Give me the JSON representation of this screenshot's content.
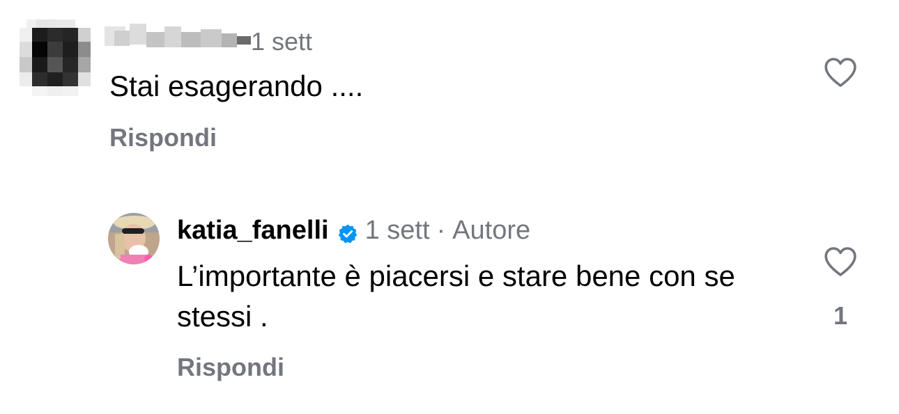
{
  "comments": [
    {
      "username_hidden": true,
      "time": "1 sett",
      "text": "Stai esagerando ....",
      "reply_label": "Rispondi",
      "like_icon": "heart-outline-icon"
    },
    {
      "username": "katia_fanelli",
      "verified": true,
      "time": "1 sett",
      "separator": "·",
      "author_badge": "Autore",
      "text": "L’importante è piacersi e stare bene con se stessi .",
      "reply_label": "Rispondi",
      "like_icon": "heart-outline-icon",
      "like_count": "1"
    }
  ],
  "colors": {
    "text": "#000000",
    "muted": "#73767d",
    "verified": "#0095f6",
    "background": "#ffffff"
  }
}
